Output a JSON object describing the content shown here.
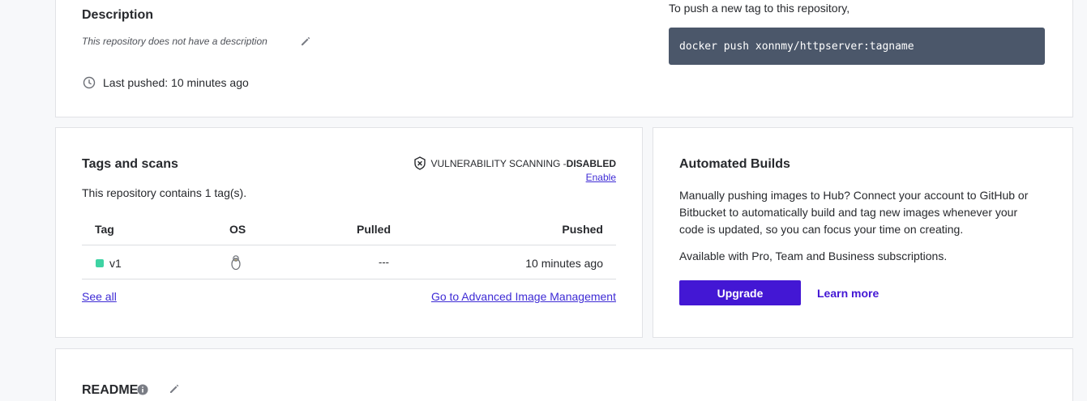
{
  "colors": {
    "accent": "#4317d4",
    "link": "#3e2bd5",
    "code_bg": "#4b576a",
    "tag_status": "#3ed3a3"
  },
  "general": {
    "description_title": "Description",
    "description_text": "This repository does not have a description",
    "last_pushed": "Last pushed: 10 minutes ago",
    "push_hint": "To push a new tag to this repository,",
    "push_command": "docker push xonnmy/httpserver:tagname"
  },
  "tags": {
    "title": "Tags and scans",
    "scan_label": "VULNERABILITY SCANNING - ",
    "scan_status": "DISABLED",
    "enable_link": "Enable",
    "summary": "This repository contains 1 tag(s).",
    "columns": {
      "tag": "Tag",
      "os": "OS",
      "pulled": "Pulled",
      "pushed": "Pushed"
    },
    "rows": [
      {
        "tag": "v1",
        "os_icon": "linux-icon",
        "pulled": "---",
        "pushed": "10 minutes ago"
      }
    ],
    "see_all": "See all",
    "advanced": "Go to Advanced Image Management"
  },
  "builds": {
    "title": "Automated Builds",
    "body": "Manually pushing images to Hub? Connect your account to GitHub or Bitbucket to automatically build and tag new images whenever your code is updated, so you can focus your time on creating.",
    "availability": "Available with Pro, Team and Business subscriptions.",
    "upgrade": "Upgrade",
    "learn_more": "Learn more"
  },
  "readme": {
    "title": "README"
  }
}
